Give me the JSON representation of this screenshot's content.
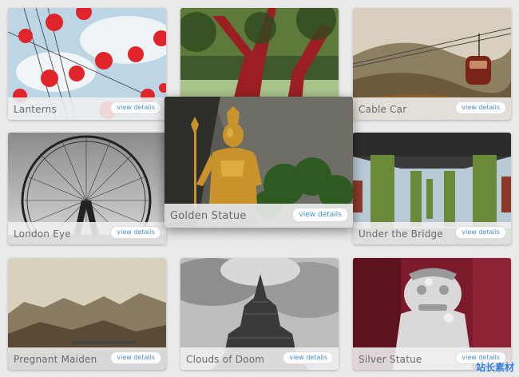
{
  "gallery": {
    "items": [
      {
        "title": "Lanterns",
        "button": "view details",
        "image": "red-lanterns-sky"
      },
      {
        "title": "",
        "button": "",
        "image": "red-trees"
      },
      {
        "title": "Cable Car",
        "button": "view details",
        "image": "cable-car-hills"
      },
      {
        "title": "London Eye",
        "button": "view details",
        "image": "ferris-wheel"
      },
      {
        "title": "Golden Statue",
        "button": "view details",
        "image": "golden-statue-cave"
      },
      {
        "title": "Under the Bridge",
        "button": "view details",
        "image": "bridge-pillars"
      },
      {
        "title": "Pregnant Maiden",
        "button": "view details",
        "image": "misty-mountains"
      },
      {
        "title": "Clouds of Doom",
        "button": "view details",
        "image": "temple-clouds"
      },
      {
        "title": "Silver Statue",
        "button": "view details",
        "image": "silver-lion-statue"
      }
    ]
  },
  "watermark": "站长素材"
}
